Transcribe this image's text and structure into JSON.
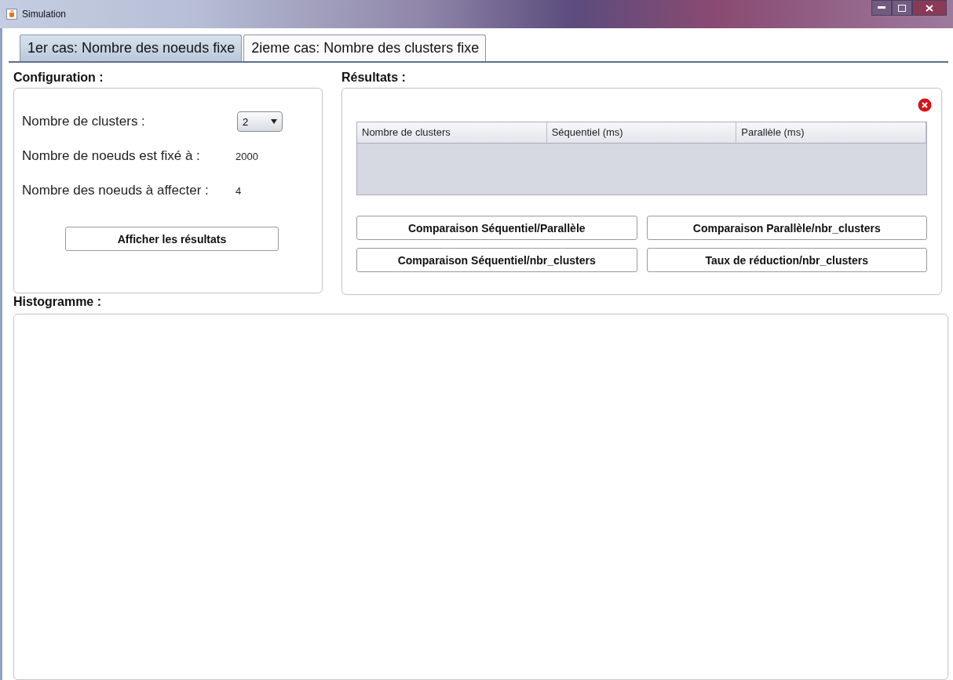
{
  "window": {
    "title": "Simulation"
  },
  "tabs": [
    {
      "label": "1er cas: Nombre des noeuds fixe",
      "selected": true
    },
    {
      "label": "2ieme cas: Nombre des clusters fixe",
      "selected": false
    }
  ],
  "configuration": {
    "title": "Configuration :",
    "clusters_label": "Nombre de clusters :",
    "clusters_value": "2",
    "nodes_label": "Nombre de noeuds est fixé à :",
    "nodes_value": "2000",
    "assign_label": "Nombre des noeuds à affecter :",
    "assign_value": "4",
    "button": "Afficher les résultats"
  },
  "results": {
    "title": "Résultats :",
    "table": {
      "columns": [
        "Nombre de clusters",
        "Séquentiel (ms)",
        "Parallèle (ms)"
      ]
    },
    "buttons": [
      "Comparaison Séquentiel/Parallèle",
      "Comparaison Parallèle/nbr_clusters",
      "Comparaison Séquentiel/nbr_clusters",
      "Taux de réduction/nbr_clusters"
    ]
  },
  "histogram": {
    "title": "Histogramme :"
  }
}
